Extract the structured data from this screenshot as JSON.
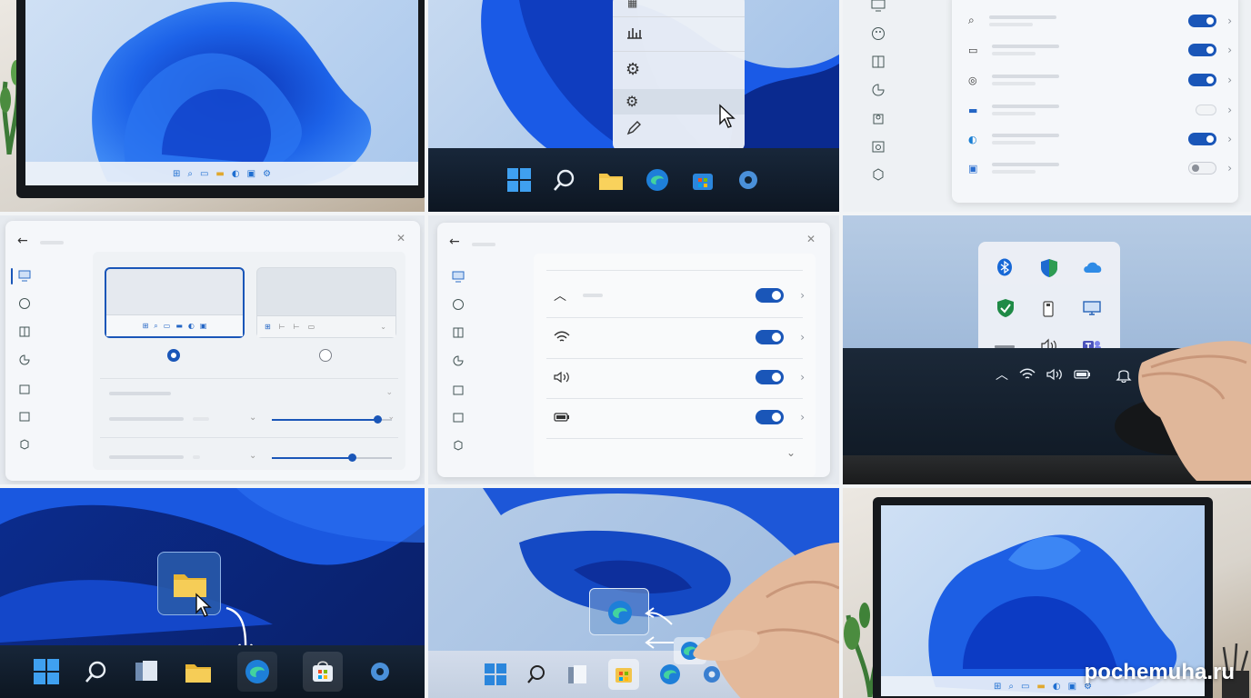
{
  "watermark": "pochemuha.ru",
  "icons": {
    "windows": "windows-logo-icon",
    "search": "search-icon",
    "file_explorer": "folder-icon",
    "edge": "edge-icon",
    "store": "store-icon",
    "settings": "gear-icon"
  },
  "colors": {
    "accent": "#1a56b8",
    "taskbar_dark": "#121d2b",
    "bloom_blue": "#1f5fe0"
  },
  "toggles_panel3": [
    true,
    true,
    true,
    false,
    true,
    false
  ],
  "toggles_panel5": [
    true,
    true,
    true,
    true
  ],
  "taskbar_position": {
    "left_selected": true,
    "center_selected": false
  },
  "sliders": [
    0.88,
    0.67
  ]
}
